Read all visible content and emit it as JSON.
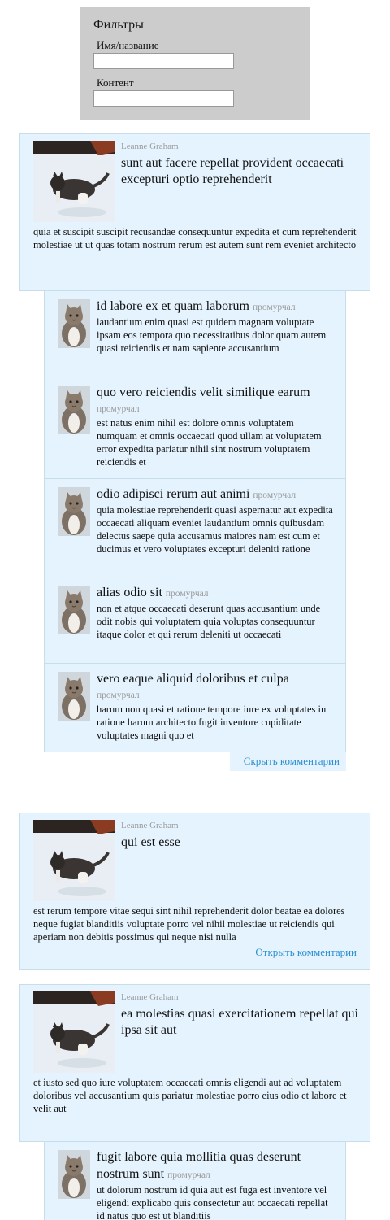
{
  "filters": {
    "title": "Фильтры",
    "name_label": "Имя/название",
    "name_value": "",
    "content_label": "Контент",
    "content_value": ""
  },
  "posts": [
    {
      "author": "Leanne Graham",
      "title": "sunt aut facere repellat provident occaecati excepturi optio reprehenderit",
      "body": "quia et suscipit suscipit recusandae consequuntur expedita et cum reprehenderit molestiae ut ut quas totam nostrum rerum est autem sunt rem eveniet architecto",
      "comments": [
        {
          "title": "id labore ex et quam laborum",
          "author": "промурчал",
          "body": "laudantium enim quasi est quidem magnam voluptate ipsam eos tempora quo necessitatibus dolor quam autem quasi reiciendis et nam sapiente accusantium"
        },
        {
          "title": "quo vero reiciendis velit similique earum",
          "author": "промурчал",
          "body": "est natus enim nihil est dolore omnis voluptatem numquam et omnis occaecati quod ullam at voluptatem error expedita pariatur nihil sint nostrum voluptatem reiciendis et"
        },
        {
          "title": "odio adipisci rerum aut animi",
          "author": "промурчал",
          "body": "quia molestiae reprehenderit quasi aspernatur aut expedita occaecati aliquam eveniet laudantium omnis quibusdam delectus saepe quia accusamus maiores nam est cum et ducimus et vero voluptates excepturi deleniti ratione"
        },
        {
          "title": "alias odio sit",
          "author": "промурчал",
          "body": "non et atque occaecati deserunt quas accusantium unde odit nobis qui voluptatem quia voluptas consequuntur itaque dolor et qui rerum deleniti ut occaecati"
        },
        {
          "title": "vero eaque aliquid doloribus et culpa",
          "author": "промурчал",
          "body": "harum non quasi et ratione tempore iure ex voluptates in ratione harum architecto fugit inventore cupiditate voluptates magni quo et"
        }
      ],
      "hide_label": "Скрыть комментарии"
    },
    {
      "author": "Leanne Graham",
      "title": "qui est esse",
      "body": "est rerum tempore vitae sequi sint nihil reprehenderit dolor beatae ea dolores neque fugiat blanditiis voluptate porro vel nihil molestiae ut reiciendis qui aperiam non debitis possimus qui neque nisi nulla",
      "open_label": "Открыть комментарии"
    },
    {
      "author": "Leanne Graham",
      "title": "ea molestias quasi exercitationem repellat qui ipsa sit aut",
      "body": "et iusto sed quo iure voluptatem occaecati omnis eligendi aut ad voluptatem doloribus vel accusantium quis pariatur molestiae porro eius odio et labore et velit aut",
      "comments": [
        {
          "title": "fugit labore quia mollitia quas deserunt nostrum sunt",
          "author": "промурчал",
          "body": "ut dolorum nostrum id quia aut est fuga est inventore vel eligendi explicabo quis consectetur aut occaecati repellat id natus quo est ut blanditiis"
        }
      ]
    }
  ]
}
